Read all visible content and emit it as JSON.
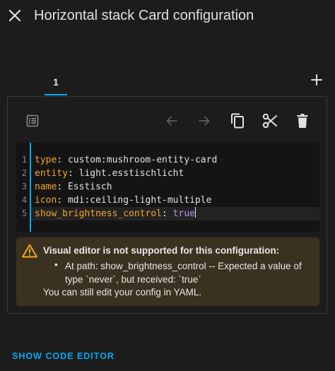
{
  "header": {
    "title": "Horizontal stack Card configuration",
    "close_icon": "close-icon"
  },
  "tabs": [
    {
      "label": "1",
      "selected": true
    }
  ],
  "add_tab_icon": "plus-icon",
  "toolbar": {
    "icons": [
      "list-edit-icon",
      "arrow-left-icon",
      "arrow-right-icon",
      "copy-icon",
      "cut-icon",
      "delete-icon"
    ]
  },
  "editor": {
    "line_numbers": [
      "1",
      "2",
      "3",
      "4",
      "5"
    ],
    "lines": [
      {
        "key": "type",
        "value": "custom:mushroom-entity-card"
      },
      {
        "key": "entity",
        "value": "light.esstischlicht"
      },
      {
        "key": "name",
        "value": "Esstisch"
      },
      {
        "key": "icon",
        "value": "mdi:ceiling-light-multiple"
      },
      {
        "key": "show_brightness_control",
        "value": "true"
      }
    ]
  },
  "warning": {
    "title": "Visual editor is not supported for this configuration:",
    "bullet": "•",
    "item": "At path: show_brightness_control -- Expected a value of type `never`, but received: `true`",
    "footer": "You can still edit your config in YAML."
  },
  "footer": {
    "show_code_label": "SHOW CODE EDITOR"
  },
  "colors": {
    "accent": "#03a9f4",
    "background": "#1c1c1c",
    "warning_bg": "#3b3120",
    "warning_icon": "#f5a623",
    "yaml_key": "#f5a623",
    "yaml_bool": "#b294f0"
  }
}
